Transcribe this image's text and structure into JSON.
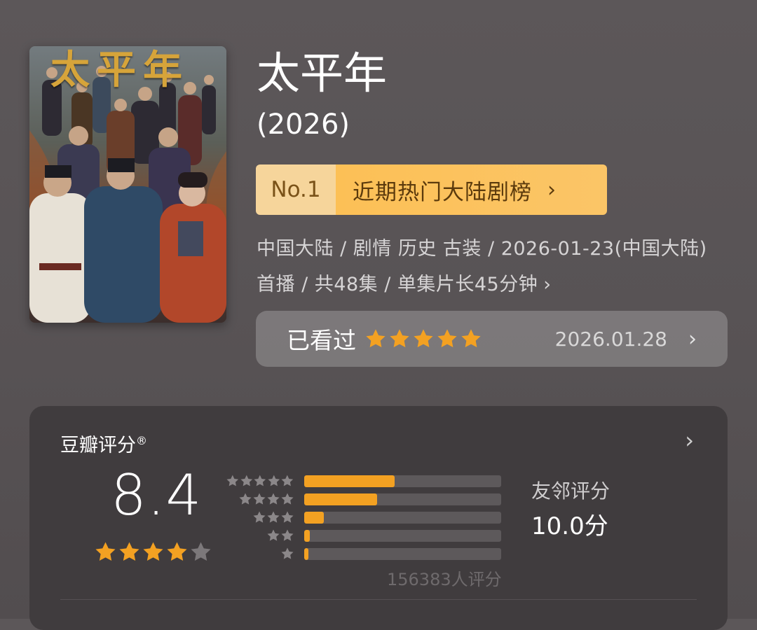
{
  "poster": {
    "text": "太平年"
  },
  "title": "太平年",
  "year": "(2026)",
  "rank": {
    "no": "No.1",
    "label": "近期热门大陆剧榜",
    "chevron": "›"
  },
  "info": {
    "text": "中国大陆 / 剧情 历史 古装 / 2026-01-23(中国大陆)首播 / 共48集 / 单集片长45分钟",
    "chevron": "›"
  },
  "watched": {
    "label": "已看过",
    "stars": 5,
    "date": "2026.01.28",
    "chevron": "›"
  },
  "rating": {
    "title": "豆瓣评分",
    "title_mark": "®",
    "score": "8.4",
    "stars": 4,
    "chevron": "›",
    "distribution": [
      {
        "stars": 5,
        "fraction": 0.46
      },
      {
        "stars": 4,
        "fraction": 0.37
      },
      {
        "stars": 3,
        "fraction": 0.1
      },
      {
        "stars": 2,
        "fraction": 0.03
      },
      {
        "stars": 1,
        "fraction": 0.02
      }
    ],
    "count": "156383人评分",
    "friends_label": "友邻评分",
    "friends_score": "10.0分"
  },
  "colors": {
    "star_on": "#f3a122",
    "star_off": "#7c787a",
    "star_dist": "#8b8789"
  }
}
